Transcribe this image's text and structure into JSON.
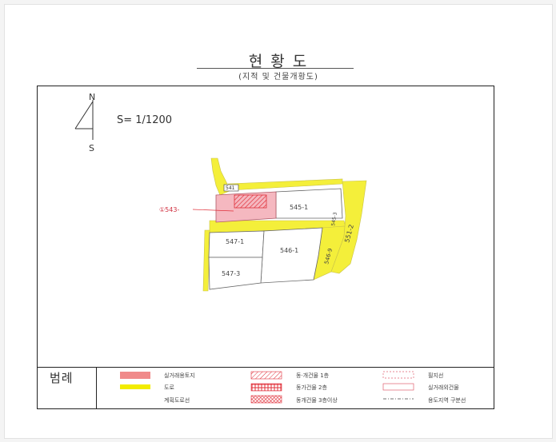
{
  "document": {
    "title": "현 황 도",
    "subtitle": "(지적 및 건물개황도)",
    "scale": "S= 1/1200"
  },
  "compass": {
    "north": "N",
    "south": "S"
  },
  "parcels": {
    "p543": "①543-",
    "p541": "541",
    "p545_1": "545-1",
    "p547_1": "547-1",
    "p546_1": "546-1",
    "p547_3": "547-3",
    "p551_2": "551-2",
    "p546_9": "546-9",
    "p545_3": "545-3"
  },
  "legend": {
    "title": "범례",
    "items": [
      {
        "label": "실거래용토지",
        "color": "#f08a8a"
      },
      {
        "label": "도로",
        "color": "#f2ec00"
      },
      {
        "label": "계획도로선"
      },
      {
        "label": "동·개건물 1층"
      },
      {
        "label": "동가건물 2층"
      },
      {
        "label": "동개건물 3층이상"
      },
      {
        "label": "필지선"
      },
      {
        "label": "실거래외건물"
      },
      {
        "label": "용도지역 구분선"
      }
    ]
  },
  "colors": {
    "target": "#f5b8c0",
    "road": "#f4ef3a",
    "hatch": "#e0303a"
  }
}
